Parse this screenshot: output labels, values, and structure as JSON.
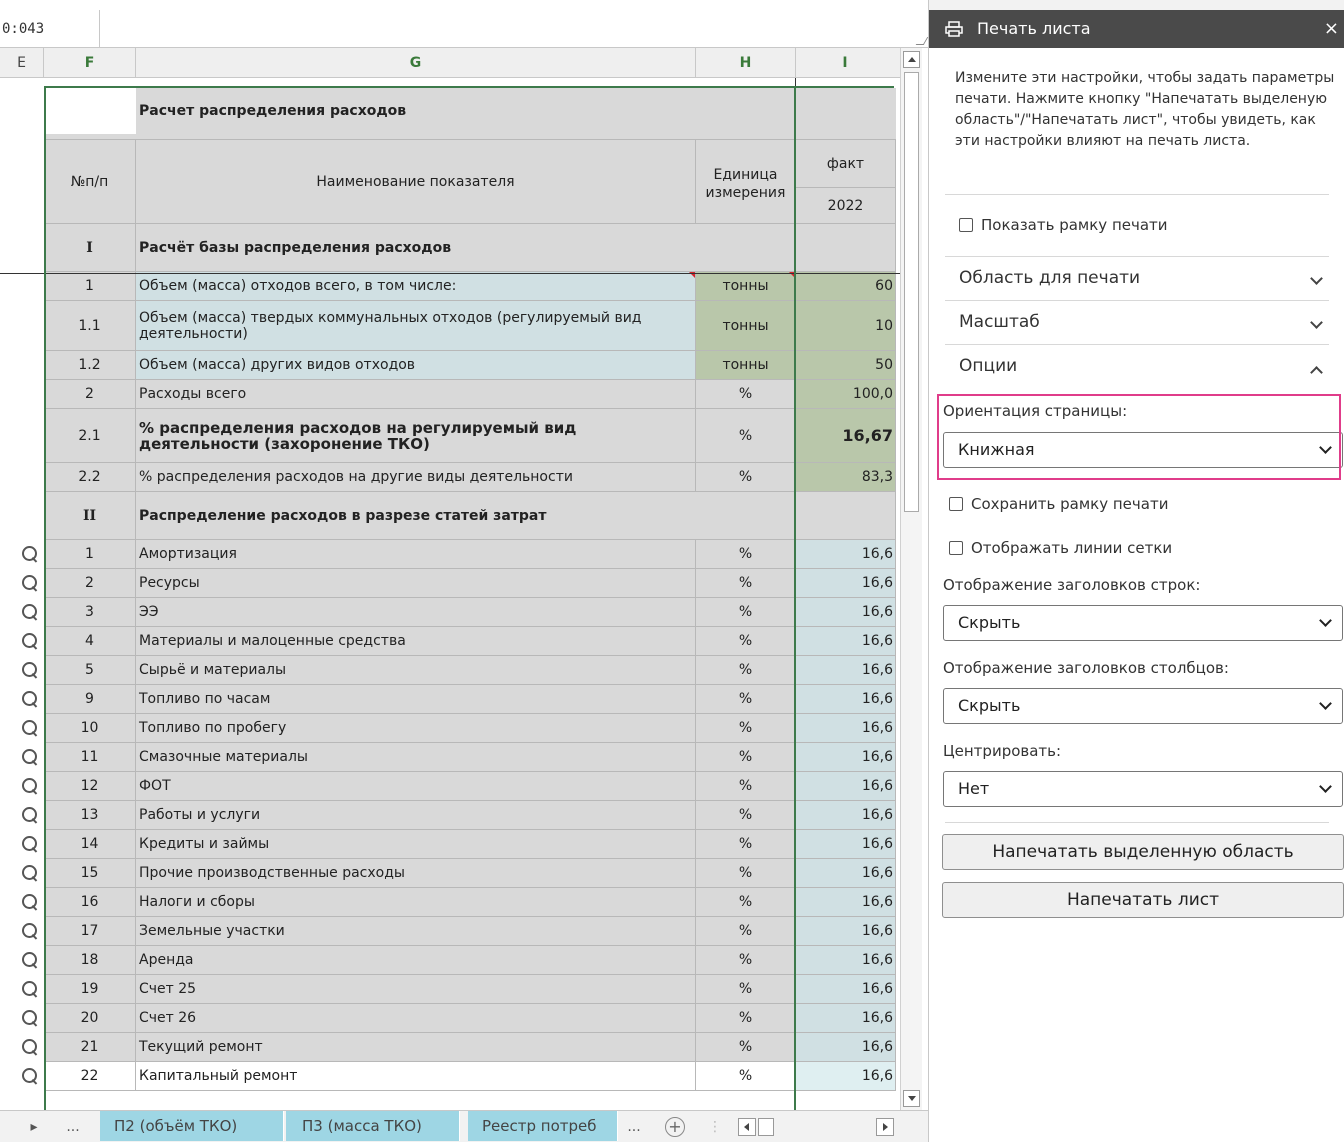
{
  "formula_bar": {
    "cell_ref": "0:043",
    "formula": ""
  },
  "columns": [
    "E",
    "F",
    "G",
    "H",
    "I"
  ],
  "sheet": {
    "title": "Расчет распределения расходов",
    "header": {
      "num": "№п/п",
      "name": "Наименование показателя",
      "unit": "Единица измерения",
      "fact": "факт",
      "year": "2022"
    },
    "rows": [
      {
        "num": "I",
        "name": "Расчёт базы распределения расходов",
        "unit": "",
        "val": "",
        "kind": "section"
      },
      {
        "num": "1",
        "name": "Объем (масса) отходов всего, в том числе:",
        "unit": "тонны",
        "val": "60",
        "kind": "blue"
      },
      {
        "num": "1.1",
        "name": "Объем (масса) твердых коммунальных отходов (регулируемый вид деятельности)",
        "unit": "тонны",
        "val": "10",
        "kind": "blue"
      },
      {
        "num": "1.2",
        "name": "Объем (масса) других видов отходов",
        "unit": "тонны",
        "val": "50",
        "kind": "blue"
      },
      {
        "num": "2",
        "name": "Расходы всего",
        "unit": "%",
        "val": "100,0",
        "kind": "plain"
      },
      {
        "num": "2.1",
        "name": "% распределения расходов на регулируемый вид деятельности (захоронение ТКО)",
        "unit": "%",
        "val": "16,67",
        "kind": "bold"
      },
      {
        "num": "2.2",
        "name": "% распределения расходов на другие виды деятельности",
        "unit": "%",
        "val": "83,3",
        "kind": "plain"
      },
      {
        "num": "II",
        "name": "Распределение расходов в разрезе статей затрат",
        "unit": "",
        "val": "",
        "kind": "section"
      },
      {
        "num": "1",
        "name": "Амортизация",
        "unit": "%",
        "val": "16,6",
        "kind": "item"
      },
      {
        "num": "2",
        "name": "Ресурсы",
        "unit": "%",
        "val": "16,6",
        "kind": "item"
      },
      {
        "num": "3",
        "name": "ЭЭ",
        "unit": "%",
        "val": "16,6",
        "kind": "item"
      },
      {
        "num": "4",
        "name": "Материалы и малоценные средства",
        "unit": "%",
        "val": "16,6",
        "kind": "item"
      },
      {
        "num": "5",
        "name": "Сырьё и материалы",
        "unit": "%",
        "val": "16,6",
        "kind": "item"
      },
      {
        "num": "9",
        "name": "Топливо по часам",
        "unit": "%",
        "val": "16,6",
        "kind": "item"
      },
      {
        "num": "10",
        "name": "Топливо по пробегу",
        "unit": "%",
        "val": "16,6",
        "kind": "item"
      },
      {
        "num": "11",
        "name": "Смазочные материалы",
        "unit": "%",
        "val": "16,6",
        "kind": "item"
      },
      {
        "num": "12",
        "name": "ФОТ",
        "unit": "%",
        "val": "16,6",
        "kind": "item"
      },
      {
        "num": "13",
        "name": "Работы и услуги",
        "unit": "%",
        "val": "16,6",
        "kind": "item"
      },
      {
        "num": "14",
        "name": "Кредиты и займы",
        "unit": "%",
        "val": "16,6",
        "kind": "item"
      },
      {
        "num": "15",
        "name": "Прочие производственные расходы",
        "unit": "%",
        "val": "16,6",
        "kind": "item"
      },
      {
        "num": "16",
        "name": "Налоги и сборы",
        "unit": "%",
        "val": "16,6",
        "kind": "item"
      },
      {
        "num": "17",
        "name": "Земельные участки",
        "unit": "%",
        "val": "16,6",
        "kind": "item"
      },
      {
        "num": "18",
        "name": "Аренда",
        "unit": "%",
        "val": "16,6",
        "kind": "item"
      },
      {
        "num": "19",
        "name": "Счет 25",
        "unit": "%",
        "val": "16,6",
        "kind": "item"
      },
      {
        "num": "20",
        "name": "Счет 26",
        "unit": "%",
        "val": "16,6",
        "kind": "item"
      },
      {
        "num": "21",
        "name": "Текущий ремонт",
        "unit": "%",
        "val": "16,6",
        "kind": "item"
      },
      {
        "num": "22",
        "name": "Капитальный ремонт",
        "unit": "%",
        "val": "16,6",
        "kind": "item-out"
      }
    ]
  },
  "tabs": {
    "ellipsis": "...",
    "items": [
      "П2 (объём ТКО)",
      "П3 (масса ТКО)",
      "Реестр потреб"
    ],
    "more": "...",
    "add": "+"
  },
  "panel": {
    "title": "Печать листа",
    "close": "×",
    "description": "Измените эти настройки, чтобы задать параметры печати. Нажмите кнопку \"Напечатать выделеную область\"/\"Напечатать лист\", чтобы увидеть, как эти настройки влияют на печать листа.",
    "show_frame": "Показать рамку печати",
    "sections": {
      "area": "Область для печати",
      "scale": "Масштаб",
      "options": "Опции"
    },
    "orientation_label": "Ориентация страницы:",
    "orientation_value": "Книжная",
    "save_frame": "Сохранить рамку печати",
    "grid_lines": "Отображать линии сетки",
    "row_headers_label": "Отображение заголовков строк:",
    "row_headers_value": "Скрыть",
    "col_headers_label": "Отображение заголовков столбцов:",
    "col_headers_value": "Скрыть",
    "center_label": "Центрировать:",
    "center_value": "Нет",
    "print_selection": "Напечатать выделенную область",
    "print_sheet": "Напечатать лист"
  }
}
